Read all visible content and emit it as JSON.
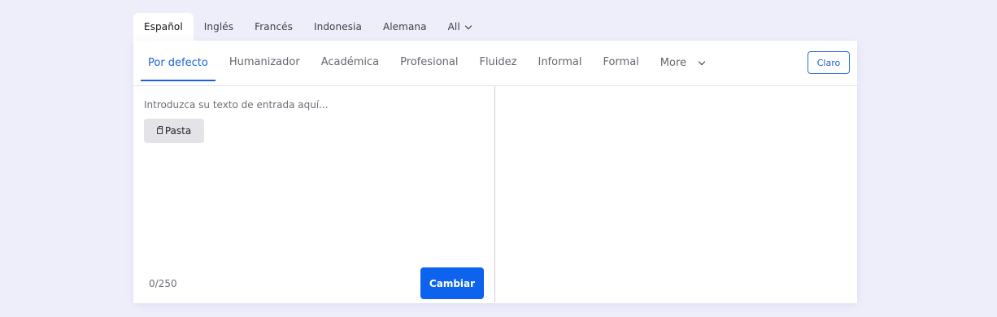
{
  "language_tabs": {
    "items": [
      "Español",
      "Inglés",
      "Francés",
      "Indonesia",
      "Alemana"
    ],
    "active_index": 0,
    "all_label": "All"
  },
  "mode_tabs": {
    "items": [
      "Por defecto",
      "Humanizador",
      "Académica",
      "Profesional",
      "Fluidez",
      "Informal",
      "Formal"
    ],
    "active_index": 0,
    "more_label": "More"
  },
  "theme_button": {
    "label": "Claro"
  },
  "input": {
    "placeholder": "Introduzca su texto de entrada aquí...",
    "paste_label": "Pasta",
    "counter": "0/250",
    "submit_label": "Cambiar"
  },
  "colors": {
    "accent": "#0d63ee",
    "background": "#eeeefb"
  }
}
